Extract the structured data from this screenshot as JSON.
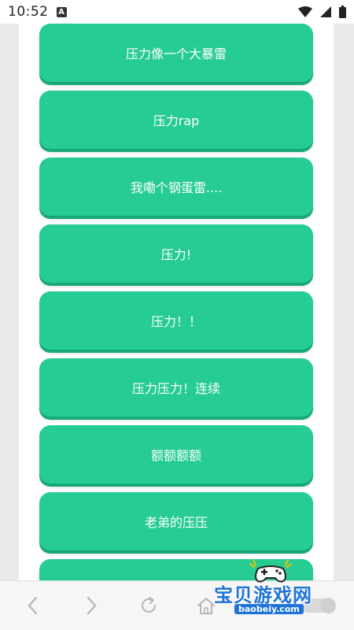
{
  "status_bar": {
    "time": "10:52",
    "notification_glyph": "A",
    "icons": [
      "wifi-icon",
      "signal-icon",
      "battery-icon"
    ]
  },
  "buttons": [
    {
      "label": "压力像一个大暴雷"
    },
    {
      "label": "压力rap"
    },
    {
      "label": "我嘞个钢蛋雷...."
    },
    {
      "label": "压力!"
    },
    {
      "label": "压力！！"
    },
    {
      "label": "压力压力！连续"
    },
    {
      "label": "额额额额"
    },
    {
      "label": "老弟的压压"
    },
    {
      "label": ""
    }
  ],
  "bottom_nav": {
    "icons": [
      "back-icon",
      "forward-icon",
      "refresh-icon",
      "home-icon",
      "toggle-switch"
    ]
  },
  "watermark": {
    "text": "宝贝游戏网",
    "url": "baobeiy.com"
  },
  "colors": {
    "button_bg": "#26cc91",
    "button_shadow": "#17a877",
    "watermark_blue": "#1e73d8"
  }
}
